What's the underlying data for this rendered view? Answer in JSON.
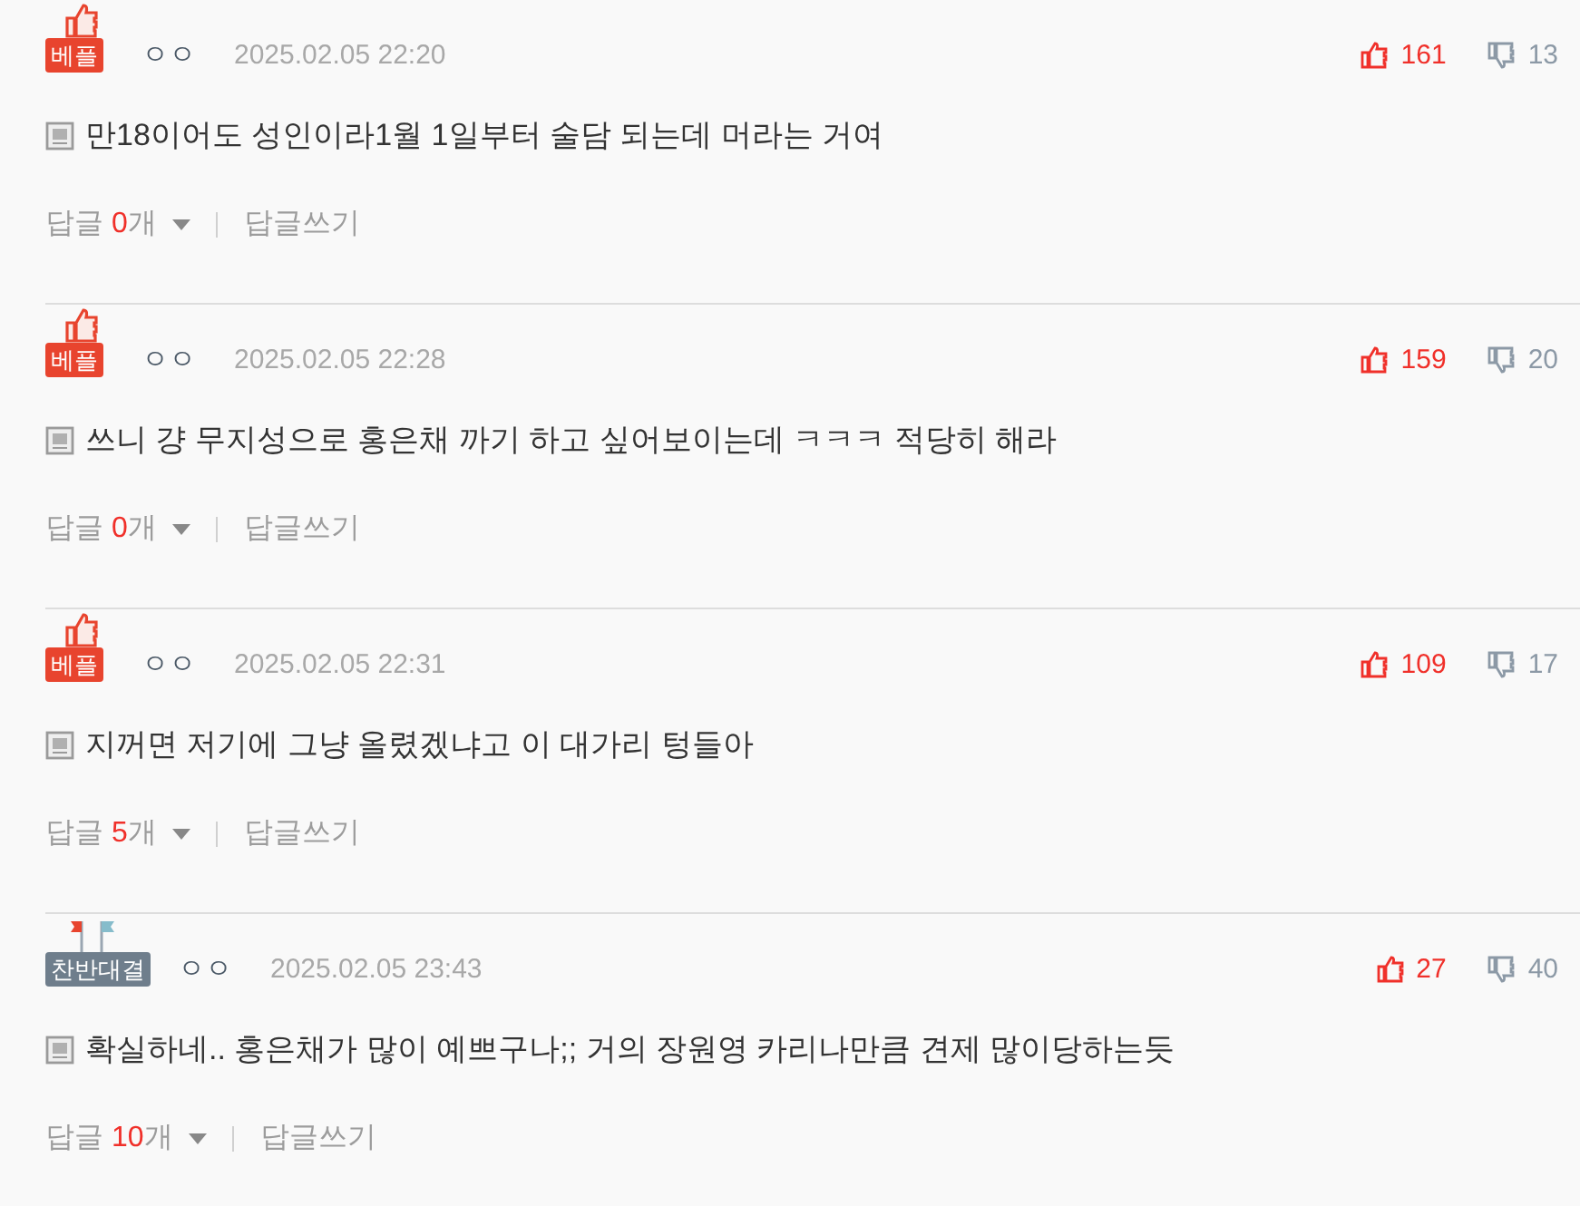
{
  "comments": [
    {
      "badge": {
        "kind": "best",
        "label": "베플"
      },
      "author": "ㅇㅇ",
      "date": "2025.02.05 22:20",
      "likes": "161",
      "dislikes": "13",
      "text": "만18이어도 성인이라1월 1일부터 술담 되는데 머라는 거여",
      "reply_label": "답글",
      "reply_count": "0",
      "reply_unit": "개",
      "write_reply": "답글쓰기"
    },
    {
      "badge": {
        "kind": "best",
        "label": "베플"
      },
      "author": "ㅇㅇ",
      "date": "2025.02.05 22:28",
      "likes": "159",
      "dislikes": "20",
      "text": "쓰니 걍 무지성으로 홍은채 까기 하고 싶어보이는데 ㅋㅋㅋ 적당히 해라",
      "reply_label": "답글",
      "reply_count": "0",
      "reply_unit": "개",
      "write_reply": "답글쓰기"
    },
    {
      "badge": {
        "kind": "best",
        "label": "베플"
      },
      "author": "ㅇㅇ",
      "date": "2025.02.05 22:31",
      "likes": "109",
      "dislikes": "17",
      "text": "지꺼면 저기에 그냥 올렸겠냐고 이 대가리 텅들아",
      "reply_label": "답글",
      "reply_count": "5",
      "reply_unit": "개",
      "write_reply": "답글쓰기"
    },
    {
      "badge": {
        "kind": "debate",
        "label": "찬반대결"
      },
      "author": "ㅇㅇ",
      "date": "2025.02.05 23:43",
      "likes": "27",
      "dislikes": "40",
      "text": "확실하네.. 홍은채가 많이 예쁘구나;; 거의 장원영 카리나만큼 견제 많이당하는듯",
      "reply_label": "답글",
      "reply_count": "10",
      "reply_unit": "개",
      "write_reply": "답글쓰기"
    }
  ]
}
